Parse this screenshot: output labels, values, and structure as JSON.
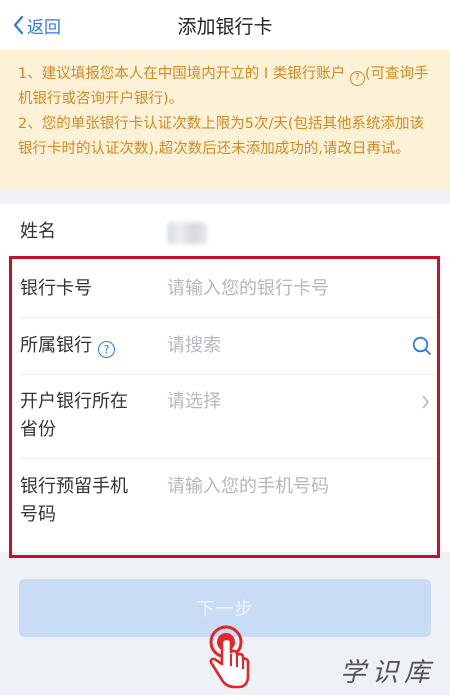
{
  "header": {
    "back_label": "返回",
    "title": "添加银行卡"
  },
  "notice": {
    "line1_part1": "1、建议填报您本人在中国境内开立的 I 类银行账户",
    "line1_part2": "(可查询手机银行或咨询开户银行)。",
    "line2": "2、您的单张银行卡认证次数上限为5次/天(包括其他系统添加该银行卡时的认证次数),超次数后还未添加成功的,请改日再试。",
    "color": "#d48a1e"
  },
  "form": {
    "name_label": "姓名",
    "card_number_label": "银行卡号",
    "card_number_placeholder": "请输入您的银行卡号",
    "bank_label": "所属银行",
    "bank_placeholder": "请搜索",
    "province_label_line1": "开户银行所在",
    "province_label_line2": "省份",
    "province_placeholder": "请选择",
    "phone_label_line1": "银行预留手机",
    "phone_label_line2": "号码",
    "phone_placeholder": "请输入您的手机号码"
  },
  "actions": {
    "next_label": "下一步"
  },
  "watermark": "学识库",
  "colors": {
    "accent": "#2b7ce9",
    "highlight_box": "#c8102e",
    "button_disabled": "#c8dcf6"
  },
  "icons": [
    "back-chevron-icon",
    "question-icon",
    "search-icon",
    "chevron-right-icon",
    "tap-hand-icon"
  ]
}
